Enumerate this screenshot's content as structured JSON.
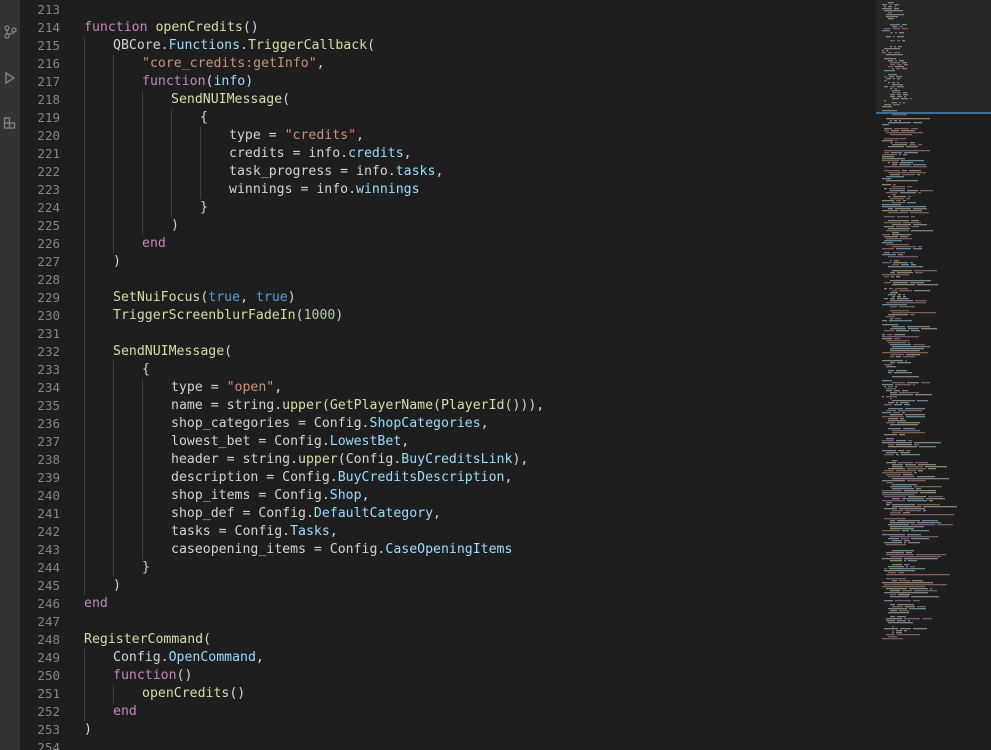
{
  "activity_bar": {
    "icons": [
      "source-control-icon",
      "run-debug-icon",
      "extensions-icon"
    ]
  },
  "editor": {
    "lines": [
      {
        "n": "213",
        "i": 0,
        "t": []
      },
      {
        "n": "214",
        "i": 0,
        "t": [
          [
            "kw",
            "function"
          ],
          [
            "var",
            " "
          ],
          [
            "fn",
            "openCredits"
          ],
          [
            "pun",
            "()"
          ]
        ]
      },
      {
        "n": "215",
        "i": 1,
        "t": [
          [
            "var",
            "QBCore"
          ],
          [
            "pun",
            "."
          ],
          [
            "prop",
            "Functions"
          ],
          [
            "pun",
            "."
          ],
          [
            "fn",
            "TriggerCallback"
          ],
          [
            "pun",
            "("
          ]
        ]
      },
      {
        "n": "216",
        "i": 2,
        "t": [
          [
            "str",
            "\"core_credits:getInfo\""
          ],
          [
            "pun",
            ","
          ]
        ]
      },
      {
        "n": "217",
        "i": 2,
        "t": [
          [
            "kw",
            "function"
          ],
          [
            "pun",
            "("
          ],
          [
            "prop",
            "info"
          ],
          [
            "pun",
            ")"
          ]
        ]
      },
      {
        "n": "218",
        "i": 3,
        "t": [
          [
            "fn",
            "SendNUIMessage"
          ],
          [
            "pun",
            "("
          ]
        ]
      },
      {
        "n": "219",
        "i": 4,
        "t": [
          [
            "pun",
            "{"
          ]
        ]
      },
      {
        "n": "220",
        "i": 5,
        "t": [
          [
            "var",
            "type = "
          ],
          [
            "str",
            "\"credits\""
          ],
          [
            "pun",
            ","
          ]
        ]
      },
      {
        "n": "221",
        "i": 5,
        "t": [
          [
            "var",
            "credits = info."
          ],
          [
            "prop",
            "credits"
          ],
          [
            "pun",
            ","
          ]
        ]
      },
      {
        "n": "222",
        "i": 5,
        "t": [
          [
            "var",
            "task_progress = info."
          ],
          [
            "prop",
            "tasks"
          ],
          [
            "pun",
            ","
          ]
        ]
      },
      {
        "n": "223",
        "i": 5,
        "t": [
          [
            "var",
            "winnings = info."
          ],
          [
            "prop",
            "winnings"
          ]
        ]
      },
      {
        "n": "224",
        "i": 4,
        "t": [
          [
            "pun",
            "}"
          ]
        ]
      },
      {
        "n": "225",
        "i": 3,
        "t": [
          [
            "pun",
            ")"
          ]
        ]
      },
      {
        "n": "226",
        "i": 2,
        "t": [
          [
            "kw",
            "end"
          ]
        ]
      },
      {
        "n": "227",
        "i": 1,
        "t": [
          [
            "pun",
            ")"
          ]
        ]
      },
      {
        "n": "228",
        "i": 0,
        "t": []
      },
      {
        "n": "229",
        "i": 1,
        "t": [
          [
            "fn",
            "SetNuiFocus"
          ],
          [
            "pun",
            "("
          ],
          [
            "bool",
            "true"
          ],
          [
            "pun",
            ", "
          ],
          [
            "bool",
            "true"
          ],
          [
            "pun",
            ")"
          ]
        ]
      },
      {
        "n": "230",
        "i": 1,
        "t": [
          [
            "fn",
            "TriggerScreenblurFadeIn"
          ],
          [
            "pun",
            "("
          ],
          [
            "num",
            "1000"
          ],
          [
            "pun",
            ")"
          ]
        ]
      },
      {
        "n": "231",
        "i": 0,
        "t": []
      },
      {
        "n": "232",
        "i": 1,
        "t": [
          [
            "fn",
            "SendNUIMessage"
          ],
          [
            "pun",
            "("
          ]
        ]
      },
      {
        "n": "233",
        "i": 2,
        "t": [
          [
            "pun",
            "{"
          ]
        ]
      },
      {
        "n": "234",
        "i": 3,
        "t": [
          [
            "var",
            "type = "
          ],
          [
            "str",
            "\"open\""
          ],
          [
            "pun",
            ","
          ]
        ]
      },
      {
        "n": "235",
        "i": 3,
        "t": [
          [
            "var",
            "name = string."
          ],
          [
            "fn",
            "upper"
          ],
          [
            "pun",
            "("
          ],
          [
            "fn",
            "GetPlayerName"
          ],
          [
            "pun",
            "("
          ],
          [
            "fn",
            "PlayerId"
          ],
          [
            "pun",
            "())),"
          ]
        ]
      },
      {
        "n": "236",
        "i": 3,
        "t": [
          [
            "var",
            "shop_categories = Config."
          ],
          [
            "prop",
            "ShopCategories"
          ],
          [
            "pun",
            ","
          ]
        ]
      },
      {
        "n": "237",
        "i": 3,
        "t": [
          [
            "var",
            "lowest_bet = Config."
          ],
          [
            "prop",
            "LowestBet"
          ],
          [
            "pun",
            ","
          ]
        ]
      },
      {
        "n": "238",
        "i": 3,
        "t": [
          [
            "var",
            "header = string."
          ],
          [
            "fn",
            "upper"
          ],
          [
            "pun",
            "(Config."
          ],
          [
            "prop",
            "BuyCreditsLink"
          ],
          [
            "pun",
            "),"
          ]
        ]
      },
      {
        "n": "239",
        "i": 3,
        "t": [
          [
            "var",
            "description = Config."
          ],
          [
            "prop",
            "BuyCreditsDescription"
          ],
          [
            "pun",
            ","
          ]
        ]
      },
      {
        "n": "240",
        "i": 3,
        "t": [
          [
            "var",
            "shop_items = Config."
          ],
          [
            "prop",
            "Shop"
          ],
          [
            "pun",
            ","
          ]
        ]
      },
      {
        "n": "241",
        "i": 3,
        "t": [
          [
            "var",
            "shop_def = Config."
          ],
          [
            "prop",
            "DefaultCategory"
          ],
          [
            "pun",
            ","
          ]
        ]
      },
      {
        "n": "242",
        "i": 3,
        "t": [
          [
            "var",
            "tasks = Config."
          ],
          [
            "prop",
            "Tasks"
          ],
          [
            "pun",
            ","
          ]
        ]
      },
      {
        "n": "243",
        "i": 3,
        "t": [
          [
            "var",
            "caseopening_items = Config."
          ],
          [
            "prop",
            "CaseOpeningItems"
          ]
        ]
      },
      {
        "n": "244",
        "i": 2,
        "t": [
          [
            "pun",
            "}"
          ]
        ]
      },
      {
        "n": "245",
        "i": 1,
        "t": [
          [
            "pun",
            ")"
          ]
        ]
      },
      {
        "n": "246",
        "i": 0,
        "t": [
          [
            "kw",
            "end"
          ]
        ]
      },
      {
        "n": "247",
        "i": 0,
        "t": []
      },
      {
        "n": "248",
        "i": 0,
        "t": [
          [
            "fn",
            "RegisterCommand"
          ],
          [
            "pun",
            "("
          ]
        ]
      },
      {
        "n": "249",
        "i": 1,
        "t": [
          [
            "var",
            "Config."
          ],
          [
            "prop",
            "OpenCommand"
          ],
          [
            "pun",
            ","
          ]
        ]
      },
      {
        "n": "250",
        "i": 1,
        "t": [
          [
            "kw",
            "function"
          ],
          [
            "pun",
            "()"
          ]
        ]
      },
      {
        "n": "251",
        "i": 2,
        "t": [
          [
            "fn",
            "openCredits"
          ],
          [
            "pun",
            "()"
          ]
        ]
      },
      {
        "n": "252",
        "i": 1,
        "t": [
          [
            "kw",
            "end"
          ]
        ]
      },
      {
        "n": "253",
        "i": 0,
        "t": [
          [
            "pun",
            ")"
          ]
        ]
      },
      {
        "n": "254",
        "i": 0,
        "t": []
      }
    ]
  },
  "colors": {
    "keyword": "#c586c0",
    "function": "#dcdcaa",
    "string": "#ce9178",
    "number": "#b5cea8",
    "boolean": "#569cd6",
    "property": "#9cdcfe",
    "text": "#d4d4d4",
    "line_number": "#858585",
    "background": "#1e1e1e",
    "activity_bar": "#333333"
  }
}
